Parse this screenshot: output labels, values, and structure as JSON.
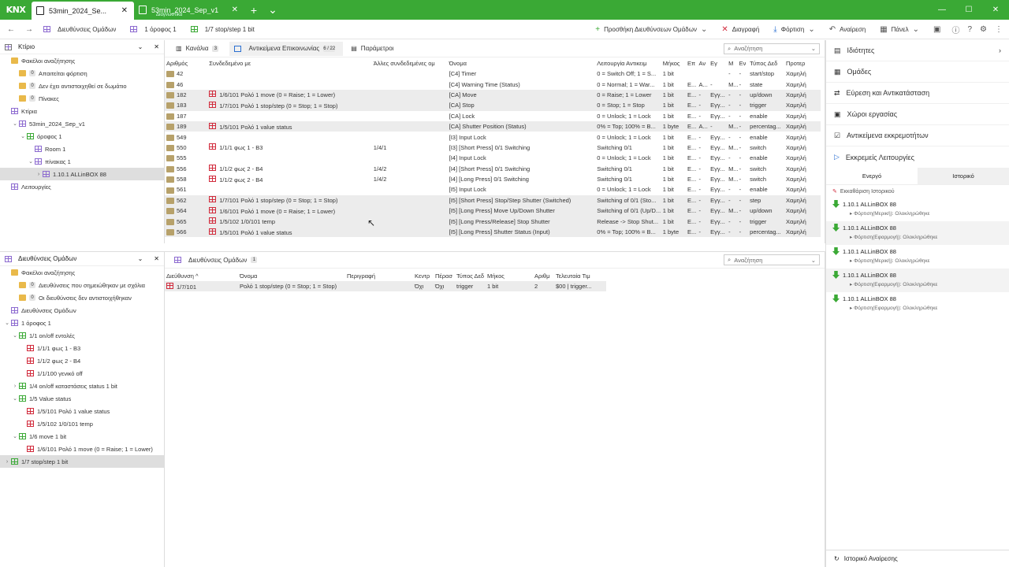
{
  "titlebar": {
    "logo": "KNX",
    "tabs": [
      {
        "label": "53min_2024_Se...",
        "sub": ""
      },
      {
        "label": "53min_2024_Sep_v1",
        "sub": "Διαγνωστικά"
      }
    ],
    "add": "+",
    "min": "—",
    "max": "☐",
    "close": "✕"
  },
  "toolbar": {
    "crumbs": [
      "Διευθύνσεις Ομάδων",
      "1 όροφος 1",
      "1/7 stop/step 1 bit"
    ],
    "actions": [
      "Προσθήκη Διευθύνσεων Ομάδων",
      "Διαγραφή",
      "Φόρτιση",
      "Αναίρεση",
      "Πάνελ"
    ]
  },
  "building": {
    "title": "Κτίριο",
    "rows": [
      {
        "label": "Φακέλοι αναζήτησης",
        "indent": 0,
        "icon": "folder"
      },
      {
        "label": "Απαιτείται φόρτιση",
        "indent": 1,
        "icon": "folder",
        "count": "0"
      },
      {
        "label": "Δεν έχει αντιστοιχηθεί σε δωμάτιο",
        "indent": 1,
        "icon": "folder",
        "count": "0"
      },
      {
        "label": "Πίνακες",
        "indent": 1,
        "icon": "folder",
        "count": "0"
      },
      {
        "label": "Κτίρια",
        "indent": 0,
        "icon": "building"
      },
      {
        "label": "53min_2024_Sep_v1",
        "indent": 1,
        "icon": "building",
        "caret": "v"
      },
      {
        "label": "όροφος 1",
        "indent": 2,
        "icon": "floor",
        "caret": "v"
      },
      {
        "label": "Room 1",
        "indent": 3,
        "icon": "room"
      },
      {
        "label": "πίνακας 1",
        "indent": 3,
        "icon": "cabinet",
        "caret": "v"
      },
      {
        "label": "1.10.1 ALLinBOX 88",
        "indent": 4,
        "icon": "device",
        "caret": ">",
        "selected": true
      },
      {
        "label": "Λειτουργίες",
        "indent": 0,
        "icon": "functions"
      }
    ]
  },
  "co_panel": {
    "tabs": [
      {
        "label": "Κανάλια",
        "count": "3"
      },
      {
        "label": "Αντικείμενα Επικοινωνίας",
        "count": "6 / 22"
      },
      {
        "label": "Παράμετροι",
        "count": ""
      }
    ],
    "search_placeholder": "Αναζήτηση",
    "headers": [
      "Αριθμός",
      "Συνδεδεμένο με",
      "Άλλες συνδεδεμένες ομ",
      "Όνομα",
      "Λειτουργία Αντικειμ",
      "Μήκος",
      "Επ",
      "Αν",
      "Εγ",
      "Μ",
      "Εν",
      "Τύπος Δεδ",
      "Προτερ"
    ],
    "rows": [
      {
        "num": "42",
        "linked": "",
        "other": "",
        "name": "[C4] Timer",
        "func": "0 = Switch Off; 1 = S...",
        "len": "1 bit",
        "c": "",
        "r": "",
        "w": "",
        "t": "-",
        "u": "-",
        "dpt": "start/stop",
        "prio": "Χαμηλή",
        "gray": false
      },
      {
        "num": "46",
        "linked": "",
        "other": "",
        "name": "[C4] Warning Time (Status)",
        "func": "0 = Normal; 1 = War...",
        "len": "1 bit",
        "c": "E...",
        "r": "A...",
        "w": "-",
        "t": "M...",
        "u": "-",
        "dpt": "state",
        "prio": "Χαμηλή",
        "gray": false
      },
      {
        "num": "182",
        "linked": "1/6/101 Ρολό 1 move (0 = Raise; 1 = Lower)",
        "other": "",
        "name": "[CA] Move",
        "func": "0 = Raise; 1 = Lower",
        "len": "1 bit",
        "c": "E...",
        "r": "-",
        "w": "Εγγ...",
        "t": "-",
        "u": "-",
        "dpt": "up/down",
        "prio": "Χαμηλή",
        "gray": true
      },
      {
        "num": "183",
        "linked": "1/7/101 Ρολό 1 stop/step (0 = Stop; 1 = Stop)",
        "other": "",
        "name": "[CA] Stop",
        "func": "0 = Stop; 1 = Stop",
        "len": "1 bit",
        "c": "E...",
        "r": "-",
        "w": "Εγγ...",
        "t": "-",
        "u": "-",
        "dpt": "trigger",
        "prio": "Χαμηλή",
        "gray": true
      },
      {
        "num": "187",
        "linked": "",
        "other": "",
        "name": "[CA] Lock",
        "func": "0 = Unlock; 1 = Lock",
        "len": "1 bit",
        "c": "E...",
        "r": "-",
        "w": "Εγγ...",
        "t": "-",
        "u": "-",
        "dpt": "enable",
        "prio": "Χαμηλή",
        "gray": false
      },
      {
        "num": "189",
        "linked": "1/5/101 Ρολό 1 value status",
        "other": "",
        "name": "[CA] Shutter Position (Status)",
        "func": "0% = Top; 100% = B...",
        "len": "1 byte",
        "c": "E...",
        "r": "A...",
        "w": "-",
        "t": "M...",
        "u": "-",
        "dpt": "percentag...",
        "prio": "Χαμηλή",
        "gray": true
      },
      {
        "num": "549",
        "linked": "",
        "other": "",
        "name": "[I3] Input Lock",
        "func": "0 = Unlock; 1 = Lock",
        "len": "1 bit",
        "c": "E...",
        "r": "-",
        "w": "Εγγ...",
        "t": "-",
        "u": "-",
        "dpt": "enable",
        "prio": "Χαμηλή",
        "gray": false
      },
      {
        "num": "550",
        "linked": "1/1/1 φως 1 - B3",
        "other": "1/4/1",
        "name": "[I3] [Short Press] 0/1 Switching",
        "func": "Switching 0/1",
        "len": "1 bit",
        "c": "E...",
        "r": "-",
        "w": "Εγγ...",
        "t": "M...",
        "u": "-",
        "dpt": "switch",
        "prio": "Χαμηλή",
        "gray": false
      },
      {
        "num": "555",
        "linked": "",
        "other": "",
        "name": "[I4] Input Lock",
        "func": "0 = Unlock; 1 = Lock",
        "len": "1 bit",
        "c": "E...",
        "r": "-",
        "w": "Εγγ...",
        "t": "-",
        "u": "-",
        "dpt": "enable",
        "prio": "Χαμηλή",
        "gray": false
      },
      {
        "num": "556",
        "linked": "1/1/2 φως 2 - B4",
        "other": "1/4/2",
        "name": "[I4] [Short Press] 0/1 Switching",
        "func": "Switching 0/1",
        "len": "1 bit",
        "c": "E...",
        "r": "-",
        "w": "Εγγ...",
        "t": "M...",
        "u": "-",
        "dpt": "switch",
        "prio": "Χαμηλή",
        "gray": false
      },
      {
        "num": "558",
        "linked": "1/1/2 φως 2 - B4",
        "other": "1/4/2",
        "name": "[I4] [Long Press] 0/1 Switching",
        "func": "Switching 0/1",
        "len": "1 bit",
        "c": "E...",
        "r": "-",
        "w": "Εγγ...",
        "t": "M...",
        "u": "-",
        "dpt": "switch",
        "prio": "Χαμηλή",
        "gray": false
      },
      {
        "num": "561",
        "linked": "",
        "other": "",
        "name": "[I5] Input Lock",
        "func": "0 = Unlock; 1 = Lock",
        "len": "1 bit",
        "c": "E...",
        "r": "-",
        "w": "Εγγ...",
        "t": "-",
        "u": "-",
        "dpt": "enable",
        "prio": "Χαμηλή",
        "gray": false
      },
      {
        "num": "562",
        "linked": "1/7/101 Ρολό 1 stop/step (0 = Stop; 1 = Stop)",
        "other": "",
        "name": "[I5] [Short Press] Stop/Step Shutter (Switched)",
        "func": "Switching of 0/1 (Sto...",
        "len": "1 bit",
        "c": "E...",
        "r": "-",
        "w": "Εγγ...",
        "t": "-",
        "u": "-",
        "dpt": "step",
        "prio": "Χαμηλή",
        "gray": true
      },
      {
        "num": "564",
        "linked": "1/6/101 Ρολό 1 move (0 = Raise; 1 = Lower)",
        "other": "",
        "name": "[I5] [Long Press] Move Up/Down Shutter",
        "func": "Switching of 0/1 (Up/D...",
        "len": "1 bit",
        "c": "E...",
        "r": "-",
        "w": "Εγγ...",
        "t": "M...",
        "u": "-",
        "dpt": "up/down",
        "prio": "Χαμηλή",
        "gray": true
      },
      {
        "num": "565",
        "linked": "1/5/102 1/0/101 temp",
        "other": "",
        "name": "[I5] [Long Press/Release] Stop Shutter",
        "func": "Release -> Stop Shut...",
        "len": "1 bit",
        "c": "E...",
        "r": "-",
        "w": "Εγγ...",
        "t": "-",
        "u": "-",
        "dpt": "trigger",
        "prio": "Χαμηλή",
        "gray": true
      },
      {
        "num": "566",
        "linked": "1/5/101 Ρολό 1 value status",
        "other": "",
        "name": "[I5] [Long Press] Shutter Status (Input)",
        "func": "0% = Top; 100% = B...",
        "len": "1 byte",
        "c": "E...",
        "r": "-",
        "w": "Εγγ...",
        "t": "-",
        "u": "-",
        "dpt": "percentag...",
        "prio": "Χαμηλή",
        "gray": true
      }
    ]
  },
  "ga_tree": {
    "title": "Διευθύνσεις Ομάδων",
    "rows": [
      {
        "label": "Φακέλοι αναζήτησης",
        "indent": 0,
        "icon": "folder"
      },
      {
        "label": "Διευθύνσεις που σημειώθηκαν με σχόλια",
        "indent": 1,
        "icon": "folder",
        "count": "0"
      },
      {
        "label": "Οι διευθύνσεις δεν αντιστοιχήθηκαν",
        "indent": 1,
        "icon": "folder",
        "count": "0"
      },
      {
        "label": "Διευθύνσεις Ομάδων",
        "indent": 0,
        "icon": "ga"
      },
      {
        "label": "1 όροφος 1",
        "indent": 0,
        "icon": "main",
        "caret": "v"
      },
      {
        "label": "1/1 on/off εντολές",
        "indent": 1,
        "icon": "middle",
        "caret": "v"
      },
      {
        "label": "1/1/1 φως 1 - B3",
        "indent": 2,
        "icon": "addr"
      },
      {
        "label": "1/1/2 φως 2 - B4",
        "indent": 2,
        "icon": "addr"
      },
      {
        "label": "1/1/100 γενικό off",
        "indent": 2,
        "icon": "addr"
      },
      {
        "label": "1/4 on/off καταστάσεις status 1 bit",
        "indent": 1,
        "icon": "middle",
        "caret": ">"
      },
      {
        "label": "1/5 Value status",
        "indent": 1,
        "icon": "middle",
        "caret": "v"
      },
      {
        "label": "1/5/101 Ρολό 1 value status",
        "indent": 2,
        "icon": "addr"
      },
      {
        "label": "1/5/102 1/0/101 temp",
        "indent": 2,
        "icon": "addr"
      },
      {
        "label": "1/6 move 1 bit",
        "indent": 1,
        "icon": "middle",
        "caret": "v"
      },
      {
        "label": "1/6/101 Ρολό 1 move (0 = Raise; 1 = Lower)",
        "indent": 2,
        "icon": "addr"
      },
      {
        "label": "1/7 stop/step 1 bit",
        "indent": 0,
        "icon": "middle",
        "caret": ">",
        "selected": true
      }
    ]
  },
  "ga_panel": {
    "tab_label": "Διευθύνσεις Ομάδων",
    "tab_count": "1",
    "search_placeholder": "Αναζήτηση",
    "headers": [
      "Διεύθυνση ^",
      "Όνομα",
      "Περιγραφή",
      "Κεντρ",
      "Πέρασ",
      "Τύπος Δεδ",
      "Μήκος",
      "Αριθμ",
      "Τελευταία Τιμ"
    ],
    "rows": [
      {
        "addr": "1/7/101",
        "name": "Ρολό 1 stop/step (0 = Stop; 1 = Stop)",
        "desc": "",
        "central": "Όχι",
        "pass": "Όχι",
        "dpt": "trigger",
        "len": "1 bit",
        "num": "2",
        "last": "$00 | trigger..."
      }
    ]
  },
  "right_panel": {
    "items": [
      "Ιδιότητες",
      "Ομάδες",
      "Εύρεση και Αντικατάσταση",
      "Χώροι εργασίας",
      "Αντικείμενα εκκρεμοτήτων",
      "Εκκρεμείς Λειτουργίες"
    ],
    "tabs": [
      "Ενεργό",
      "Ιστορικό"
    ],
    "clear_history": "Εκκαθάριση Ιστορικού",
    "history": [
      {
        "device": "1.10.1 ALLinBOX 88",
        "status": "Φόρτιση(Μερική): Ολοκληρώθηκε"
      },
      {
        "device": "1.10.1 ALLinBOX 88",
        "status": "Φόρτιση(Εφαρμογή): Ολοκληρώθηκε"
      },
      {
        "device": "1.10.1 ALLinBOX 88",
        "status": "Φόρτιση(Μερική): Ολοκληρώθηκε"
      },
      {
        "device": "1.10.1 ALLinBOX 88",
        "status": "Φόρτιση(Εφαρμογή): Ολοκληρώθηκε"
      },
      {
        "device": "1.10.1 ALLinBOX 88",
        "status": "Φόρτιση(Εφαρμογή): Ολοκληρώθηκε"
      }
    ],
    "footer": "Ιστορικό Αναίρεσης"
  },
  "colors": {
    "brand": "#3aa935",
    "ga_red": "#d12a3b",
    "ga_purple": "#8d6bd0"
  }
}
